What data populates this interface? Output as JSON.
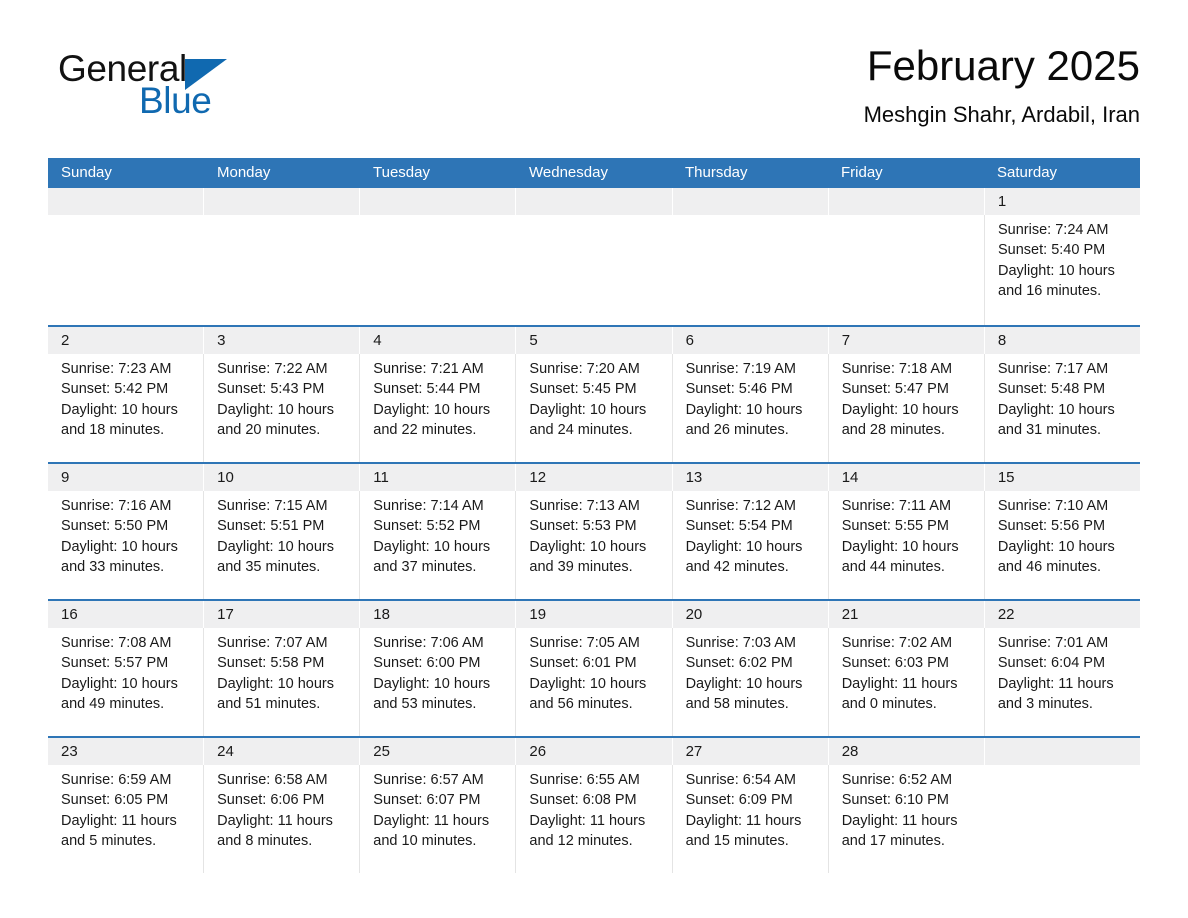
{
  "brand": {
    "name_part1": "General",
    "name_part2": "Blue",
    "triangle_color": "#1069b0"
  },
  "header": {
    "title": "February 2025",
    "subtitle": "Meshgin Shahr, Ardabil, Iran"
  },
  "colors": {
    "header_blue": "#2e75b6",
    "daynum_band": "#efeff0",
    "text": "#1a1a1a",
    "background": "#ffffff"
  },
  "weekday_headers": [
    "Sunday",
    "Monday",
    "Tuesday",
    "Wednesday",
    "Thursday",
    "Friday",
    "Saturday"
  ],
  "weeks": [
    {
      "days": [
        {
          "num": "",
          "sunrise": "",
          "sunset": "",
          "daylight_1": "",
          "daylight_2": ""
        },
        {
          "num": "",
          "sunrise": "",
          "sunset": "",
          "daylight_1": "",
          "daylight_2": ""
        },
        {
          "num": "",
          "sunrise": "",
          "sunset": "",
          "daylight_1": "",
          "daylight_2": ""
        },
        {
          "num": "",
          "sunrise": "",
          "sunset": "",
          "daylight_1": "",
          "daylight_2": ""
        },
        {
          "num": "",
          "sunrise": "",
          "sunset": "",
          "daylight_1": "",
          "daylight_2": ""
        },
        {
          "num": "",
          "sunrise": "",
          "sunset": "",
          "daylight_1": "",
          "daylight_2": ""
        },
        {
          "num": "1",
          "sunrise": "Sunrise: 7:24 AM",
          "sunset": "Sunset: 5:40 PM",
          "daylight_1": "Daylight: 10 hours",
          "daylight_2": "and 16 minutes."
        }
      ]
    },
    {
      "days": [
        {
          "num": "2",
          "sunrise": "Sunrise: 7:23 AM",
          "sunset": "Sunset: 5:42 PM",
          "daylight_1": "Daylight: 10 hours",
          "daylight_2": "and 18 minutes."
        },
        {
          "num": "3",
          "sunrise": "Sunrise: 7:22 AM",
          "sunset": "Sunset: 5:43 PM",
          "daylight_1": "Daylight: 10 hours",
          "daylight_2": "and 20 minutes."
        },
        {
          "num": "4",
          "sunrise": "Sunrise: 7:21 AM",
          "sunset": "Sunset: 5:44 PM",
          "daylight_1": "Daylight: 10 hours",
          "daylight_2": "and 22 minutes."
        },
        {
          "num": "5",
          "sunrise": "Sunrise: 7:20 AM",
          "sunset": "Sunset: 5:45 PM",
          "daylight_1": "Daylight: 10 hours",
          "daylight_2": "and 24 minutes."
        },
        {
          "num": "6",
          "sunrise": "Sunrise: 7:19 AM",
          "sunset": "Sunset: 5:46 PM",
          "daylight_1": "Daylight: 10 hours",
          "daylight_2": "and 26 minutes."
        },
        {
          "num": "7",
          "sunrise": "Sunrise: 7:18 AM",
          "sunset": "Sunset: 5:47 PM",
          "daylight_1": "Daylight: 10 hours",
          "daylight_2": "and 28 minutes."
        },
        {
          "num": "8",
          "sunrise": "Sunrise: 7:17 AM",
          "sunset": "Sunset: 5:48 PM",
          "daylight_1": "Daylight: 10 hours",
          "daylight_2": "and 31 minutes."
        }
      ]
    },
    {
      "days": [
        {
          "num": "9",
          "sunrise": "Sunrise: 7:16 AM",
          "sunset": "Sunset: 5:50 PM",
          "daylight_1": "Daylight: 10 hours",
          "daylight_2": "and 33 minutes."
        },
        {
          "num": "10",
          "sunrise": "Sunrise: 7:15 AM",
          "sunset": "Sunset: 5:51 PM",
          "daylight_1": "Daylight: 10 hours",
          "daylight_2": "and 35 minutes."
        },
        {
          "num": "11",
          "sunrise": "Sunrise: 7:14 AM",
          "sunset": "Sunset: 5:52 PM",
          "daylight_1": "Daylight: 10 hours",
          "daylight_2": "and 37 minutes."
        },
        {
          "num": "12",
          "sunrise": "Sunrise: 7:13 AM",
          "sunset": "Sunset: 5:53 PM",
          "daylight_1": "Daylight: 10 hours",
          "daylight_2": "and 39 minutes."
        },
        {
          "num": "13",
          "sunrise": "Sunrise: 7:12 AM",
          "sunset": "Sunset: 5:54 PM",
          "daylight_1": "Daylight: 10 hours",
          "daylight_2": "and 42 minutes."
        },
        {
          "num": "14",
          "sunrise": "Sunrise: 7:11 AM",
          "sunset": "Sunset: 5:55 PM",
          "daylight_1": "Daylight: 10 hours",
          "daylight_2": "and 44 minutes."
        },
        {
          "num": "15",
          "sunrise": "Sunrise: 7:10 AM",
          "sunset": "Sunset: 5:56 PM",
          "daylight_1": "Daylight: 10 hours",
          "daylight_2": "and 46 minutes."
        }
      ]
    },
    {
      "days": [
        {
          "num": "16",
          "sunrise": "Sunrise: 7:08 AM",
          "sunset": "Sunset: 5:57 PM",
          "daylight_1": "Daylight: 10 hours",
          "daylight_2": "and 49 minutes."
        },
        {
          "num": "17",
          "sunrise": "Sunrise: 7:07 AM",
          "sunset": "Sunset: 5:58 PM",
          "daylight_1": "Daylight: 10 hours",
          "daylight_2": "and 51 minutes."
        },
        {
          "num": "18",
          "sunrise": "Sunrise: 7:06 AM",
          "sunset": "Sunset: 6:00 PM",
          "daylight_1": "Daylight: 10 hours",
          "daylight_2": "and 53 minutes."
        },
        {
          "num": "19",
          "sunrise": "Sunrise: 7:05 AM",
          "sunset": "Sunset: 6:01 PM",
          "daylight_1": "Daylight: 10 hours",
          "daylight_2": "and 56 minutes."
        },
        {
          "num": "20",
          "sunrise": "Sunrise: 7:03 AM",
          "sunset": "Sunset: 6:02 PM",
          "daylight_1": "Daylight: 10 hours",
          "daylight_2": "and 58 minutes."
        },
        {
          "num": "21",
          "sunrise": "Sunrise: 7:02 AM",
          "sunset": "Sunset: 6:03 PM",
          "daylight_1": "Daylight: 11 hours",
          "daylight_2": "and 0 minutes."
        },
        {
          "num": "22",
          "sunrise": "Sunrise: 7:01 AM",
          "sunset": "Sunset: 6:04 PM",
          "daylight_1": "Daylight: 11 hours",
          "daylight_2": "and 3 minutes."
        }
      ]
    },
    {
      "days": [
        {
          "num": "23",
          "sunrise": "Sunrise: 6:59 AM",
          "sunset": "Sunset: 6:05 PM",
          "daylight_1": "Daylight: 11 hours",
          "daylight_2": "and 5 minutes."
        },
        {
          "num": "24",
          "sunrise": "Sunrise: 6:58 AM",
          "sunset": "Sunset: 6:06 PM",
          "daylight_1": "Daylight: 11 hours",
          "daylight_2": "and 8 minutes."
        },
        {
          "num": "25",
          "sunrise": "Sunrise: 6:57 AM",
          "sunset": "Sunset: 6:07 PM",
          "daylight_1": "Daylight: 11 hours",
          "daylight_2": "and 10 minutes."
        },
        {
          "num": "26",
          "sunrise": "Sunrise: 6:55 AM",
          "sunset": "Sunset: 6:08 PM",
          "daylight_1": "Daylight: 11 hours",
          "daylight_2": "and 12 minutes."
        },
        {
          "num": "27",
          "sunrise": "Sunrise: 6:54 AM",
          "sunset": "Sunset: 6:09 PM",
          "daylight_1": "Daylight: 11 hours",
          "daylight_2": "and 15 minutes."
        },
        {
          "num": "28",
          "sunrise": "Sunrise: 6:52 AM",
          "sunset": "Sunset: 6:10 PM",
          "daylight_1": "Daylight: 11 hours",
          "daylight_2": "and 17 minutes."
        },
        {
          "num": "",
          "sunrise": "",
          "sunset": "",
          "daylight_1": "",
          "daylight_2": ""
        }
      ]
    }
  ]
}
